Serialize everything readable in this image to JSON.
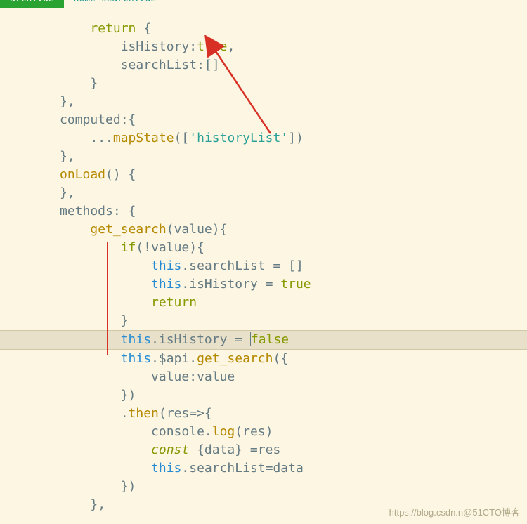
{
  "tabs": {
    "active": "arch.vue",
    "inactive": "home-search.vue"
  },
  "code": {
    "l1_return": "return",
    "l1_brace": " {",
    "l2_prop": "isHistory:",
    "l2_val": "true",
    "l2_comma": ",",
    "l3_prop": "searchList:[]",
    "l4_brace": "}",
    "l5_brace": "},",
    "l6_computed": "computed:{",
    "l7_spread": "...",
    "l7_method": "mapState",
    "l7_paren": "([",
    "l7_str": "'historyList'",
    "l7_close": "])",
    "l8_brace": "},",
    "l9_onload": "onLoad",
    "l9_paren": "() {",
    "l10_brace": "},",
    "l11_methods": "methods: {",
    "l12_method": "get_search",
    "l12_param": "(value){",
    "l13_if": "if",
    "l13_cond": "(!value){",
    "l14_this": "this",
    "l14_prop": ".searchList = []",
    "l15_this": "this",
    "l15_prop": ".isHistory = ",
    "l15_val": "true",
    "l16_return": "return",
    "l17_brace": "}",
    "l18_this": "this",
    "l18_prop": ".isHistory = ",
    "l18_val": "false",
    "l19_this": "this",
    "l19_prop": ".$api.",
    "l19_method": "get_search",
    "l19_paren": "({",
    "l20_prop": "value:value",
    "l21_brace": "})",
    "l22_then": ".",
    "l22_method": "then",
    "l22_arrow": "(res=>{",
    "l23_console": "console.",
    "l23_log": "log",
    "l23_res": "(res)",
    "l24_const": "const",
    "l24_destr": " {data} =res",
    "l25_this": "this",
    "l25_prop": ".searchList=data",
    "l26_brace": "})",
    "l27_brace": "},"
  },
  "watermark": "https://blog.csdn.n@51CTO博客"
}
